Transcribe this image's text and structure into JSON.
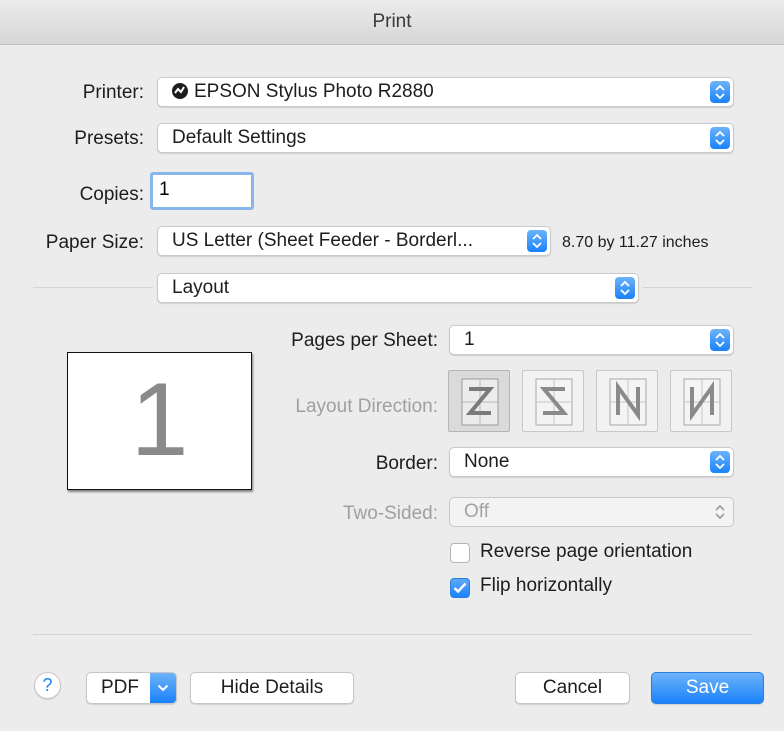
{
  "window": {
    "title": "Print"
  },
  "printer": {
    "label": "Printer:",
    "value": "EPSON Stylus Photo R2880",
    "status_icon": "printer-status-icon"
  },
  "presets": {
    "label": "Presets:",
    "value": "Default Settings"
  },
  "copies": {
    "label": "Copies:",
    "value": "1"
  },
  "paper_size": {
    "label": "Paper Size:",
    "value": "US Letter (Sheet Feeder - Borderl...",
    "dimensions": "8.70 by 11.27 inches"
  },
  "section": {
    "value": "Layout"
  },
  "preview": {
    "page_number": "1"
  },
  "layout": {
    "pages_per_sheet": {
      "label": "Pages per Sheet:",
      "value": "1"
    },
    "layout_direction": {
      "label": "Layout Direction:",
      "options": [
        "Z-left-to-right",
        "S-right-to-left",
        "N-top-down-left",
        "N-top-down-right"
      ],
      "selected_index": 0
    },
    "border": {
      "label": "Border:",
      "value": "None"
    },
    "two_sided": {
      "label": "Two-Sided:",
      "value": "Off",
      "enabled": false
    },
    "reverse_orientation": {
      "label": "Reverse page orientation",
      "checked": false
    },
    "flip_horizontally": {
      "label": "Flip horizontally",
      "checked": true
    }
  },
  "footer": {
    "help": "?",
    "pdf": "PDF",
    "hide_details": "Hide Details",
    "cancel": "Cancel",
    "save": "Save"
  },
  "colors": {
    "accent": "#1a82fb",
    "focus_ring": "#89b6ea",
    "background": "#ececec"
  }
}
